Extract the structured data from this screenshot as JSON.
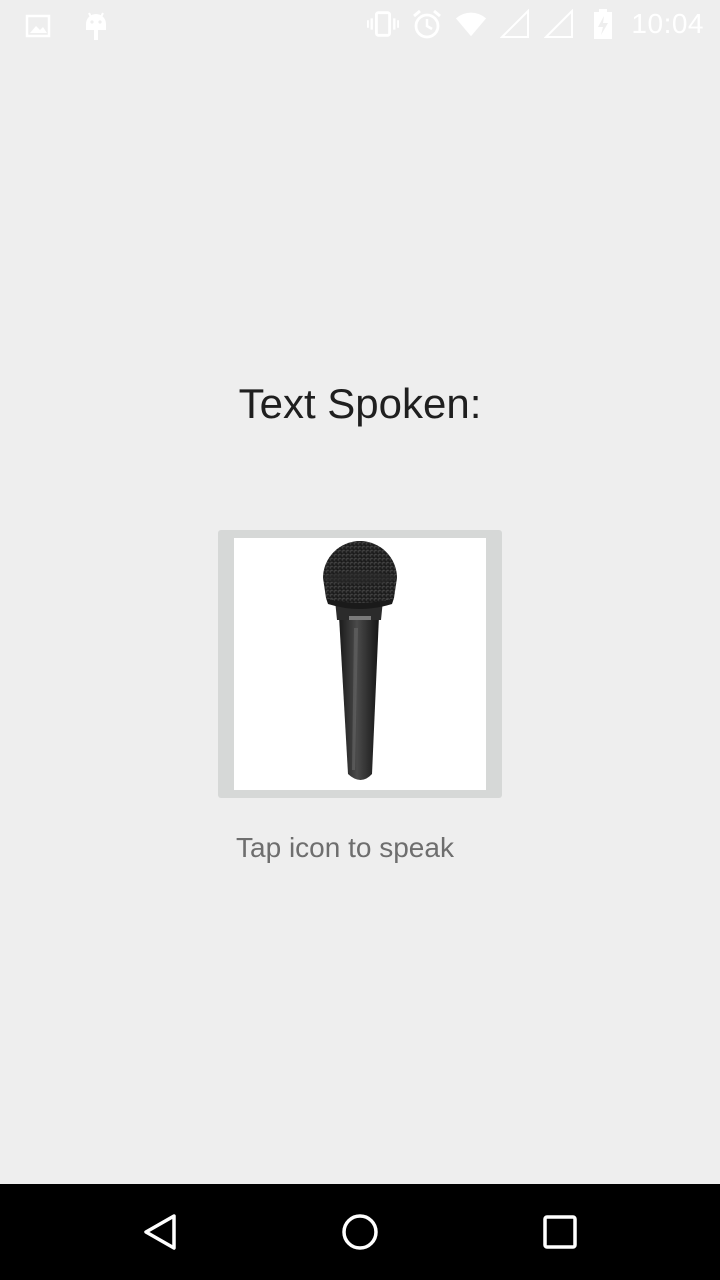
{
  "status_bar": {
    "time": "10:04",
    "left_icons": [
      "image-icon",
      "android-icon"
    ],
    "right_icons": [
      "vibrate-icon",
      "alarm-icon",
      "wifi-icon",
      "signal-icon",
      "signal-icon-2",
      "battery-charging-icon"
    ]
  },
  "main": {
    "title": "Text Spoken:",
    "mic_icon": "microphone-icon",
    "hint": "Tap icon to speak"
  },
  "nav_bar": {
    "back_icon": "back-icon",
    "home_icon": "home-icon",
    "recents_icon": "recents-icon"
  },
  "colors": {
    "background": "#eeeeee",
    "mic_frame": "#d6d8d7",
    "title_text": "#1f1f1f",
    "hint_text": "#6e6e6e",
    "nav_bar": "#000000"
  }
}
